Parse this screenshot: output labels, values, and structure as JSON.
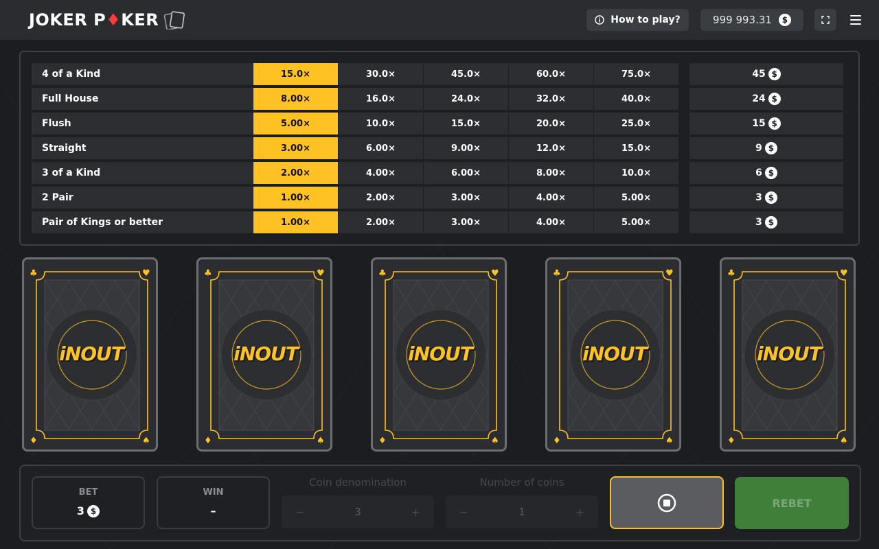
{
  "header": {
    "logo_text_a": "JOKER P",
    "logo_diamond": "♦",
    "logo_text_b": "KER",
    "help_label": "How to play?",
    "balance": "999 993.31",
    "currency_symbol": "$",
    "icons": [
      "info-icon",
      "coin-icon",
      "fullscreen-icon",
      "menu-icon",
      "cards-icon"
    ]
  },
  "paytable": {
    "rows": [
      {
        "hand": "4 of a Kind",
        "m1": "15.0×",
        "m2": "30.0×",
        "m3": "45.0×",
        "m4": "60.0×",
        "m5": "75.0×",
        "win": "45"
      },
      {
        "hand": "Full House",
        "m1": "8.00×",
        "m2": "16.0×",
        "m3": "24.0×",
        "m4": "32.0×",
        "m5": "40.0×",
        "win": "24"
      },
      {
        "hand": "Flush",
        "m1": "5.00×",
        "m2": "10.0×",
        "m3": "15.0×",
        "m4": "20.0×",
        "m5": "25.0×",
        "win": "15"
      },
      {
        "hand": "Straight",
        "m1": "3.00×",
        "m2": "6.00×",
        "m3": "9.00×",
        "m4": "12.0×",
        "m5": "15.0×",
        "win": "9"
      },
      {
        "hand": "3 of a Kind",
        "m1": "2.00×",
        "m2": "4.00×",
        "m3": "6.00×",
        "m4": "8.00×",
        "m5": "10.0×",
        "win": "6"
      },
      {
        "hand": "2 Pair",
        "m1": "1.00×",
        "m2": "2.00×",
        "m3": "3.00×",
        "m4": "4.00×",
        "m5": "5.00×",
        "win": "3"
      },
      {
        "hand": "Pair of Kings or better",
        "m1": "1.00×",
        "m2": "2.00×",
        "m3": "3.00×",
        "m4": "4.00×",
        "m5": "5.00×",
        "win": "3"
      }
    ],
    "highlight_color": "#ffc224"
  },
  "cards": {
    "back_logo": "iNOUT",
    "corner_suits": [
      "♣",
      "♥",
      "♦",
      "♠"
    ]
  },
  "controls": {
    "bet_label": "BET",
    "bet_value": "3",
    "win_label": "WIN",
    "win_value": "–",
    "coin_denom_label": "Coin denomination",
    "coin_denom_value": "3",
    "num_coins_label": "Number of coins",
    "num_coins_value": "1",
    "minus": "−",
    "plus": "+",
    "rebet_label": "REBET"
  },
  "colors": {
    "accent": "#ffc224",
    "rebet": "#3f7f3a",
    "logo_diamond": "#ff3b3b"
  }
}
